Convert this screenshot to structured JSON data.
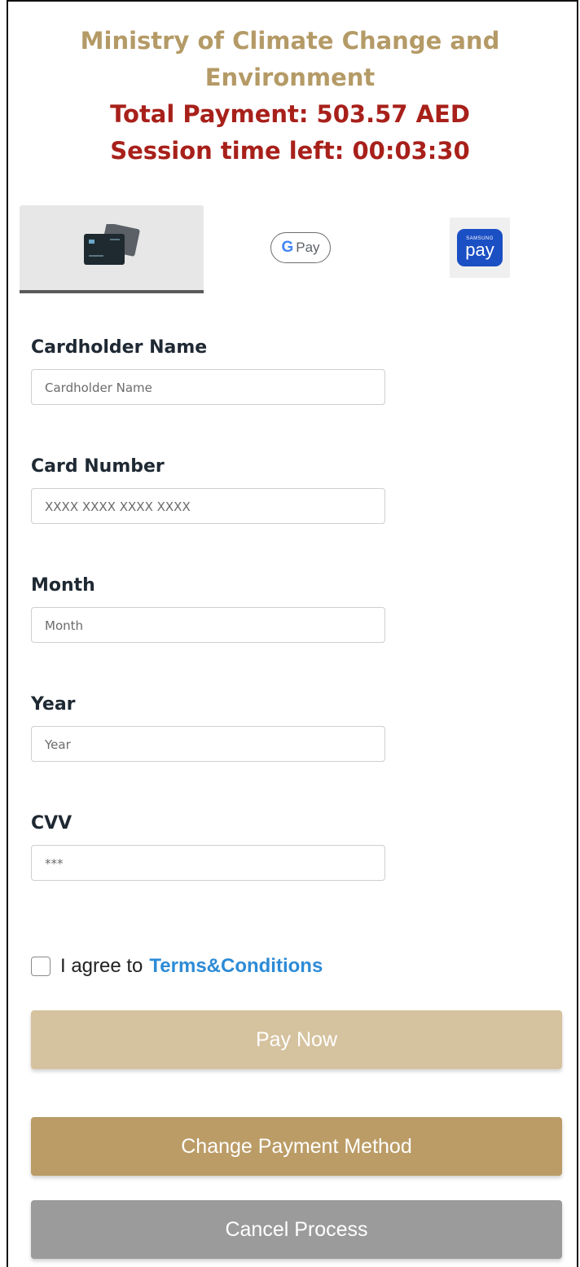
{
  "header": {
    "organization_line1": "Ministry of Climate Change and",
    "organization_line2": "Environment",
    "total_payment": "Total Payment: 503.57 AED",
    "session_time": "Session time left: 00:03:30"
  },
  "payment_methods": {
    "selected": "card",
    "gpay_label": "Pay",
    "gpay_g": "G",
    "samsung_small": "SAMSUNG",
    "samsung_label": "pay"
  },
  "form": {
    "cardholder": {
      "label": "Cardholder Name",
      "placeholder": "Cardholder Name",
      "value": ""
    },
    "card_number": {
      "label": "Card Number",
      "placeholder": "XXXX XXXX XXXX XXXX",
      "value": ""
    },
    "month": {
      "label": "Month",
      "placeholder": "Month",
      "value": ""
    },
    "year": {
      "label": "Year",
      "placeholder": "Year",
      "value": ""
    },
    "cvv": {
      "label": "CVV",
      "placeholder": "***",
      "value": ""
    }
  },
  "agree": {
    "text": "I agree to",
    "link": "Terms&Conditions",
    "checked": false
  },
  "buttons": {
    "pay_now": "Pay Now",
    "change_method": "Change Payment Method",
    "cancel": "Cancel Process"
  },
  "colors": {
    "brand_gold": "#b49a66",
    "alert_red": "#a8201a",
    "link_blue": "#2d8bd6",
    "pay_button": "#d5c29e",
    "change_button": "#bb9c66",
    "cancel_button": "#9b9b9b"
  },
  "icons": {
    "card": "credit-card-icon",
    "gpay": "google-pay-icon",
    "samsung": "samsung-pay-icon",
    "checkbox": "checkbox-icon"
  }
}
